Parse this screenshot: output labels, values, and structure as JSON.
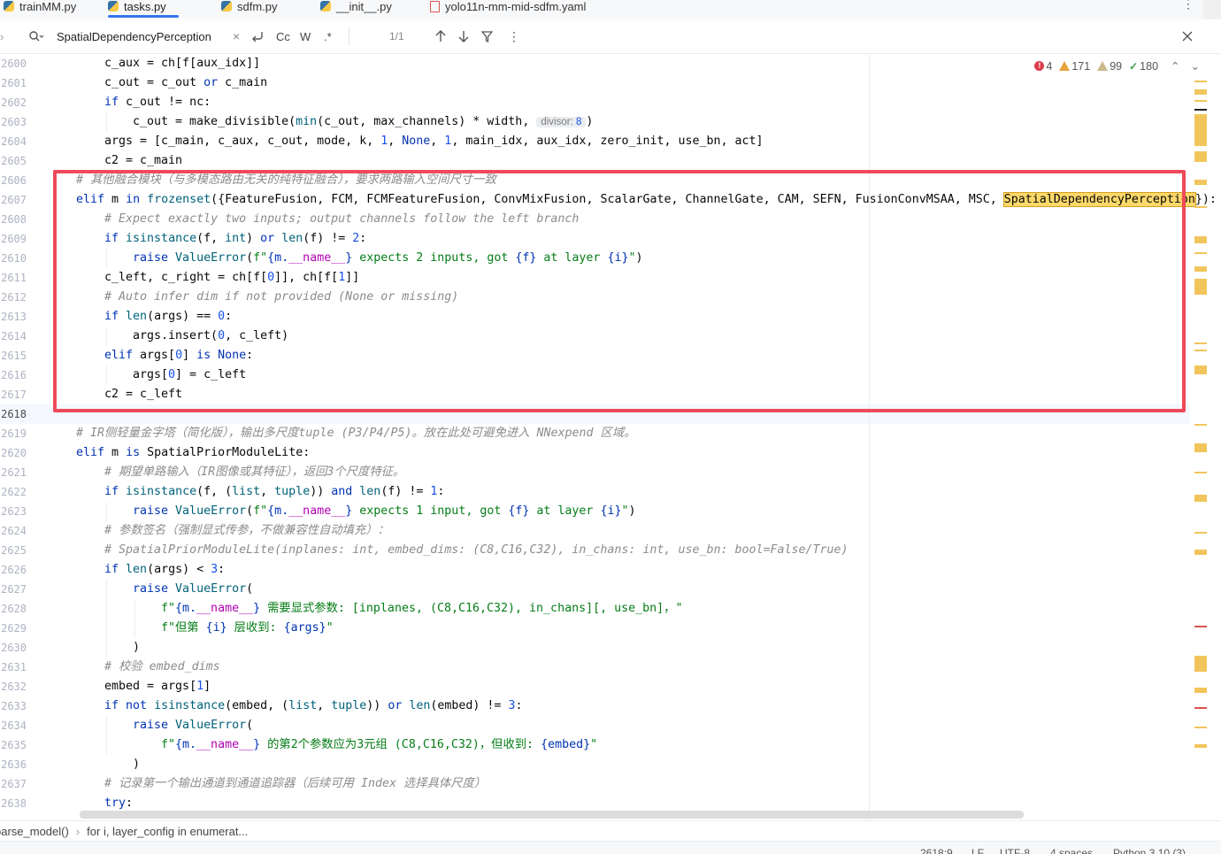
{
  "tabs": [
    {
      "label": "trainMM.py",
      "type": "python",
      "active": false
    },
    {
      "label": "tasks.py",
      "type": "python",
      "active": true
    },
    {
      "label": "sdfm.py",
      "type": "python",
      "active": false
    },
    {
      "label": "__init__.py",
      "type": "python",
      "active": false
    },
    {
      "label": "yolo11n-mm-mid-sdfm.yaml",
      "type": "yaml",
      "active": false
    }
  ],
  "find": {
    "query": "SpatialDependencyPerception",
    "match_case": "Cc",
    "words": "W",
    "regex": ".*",
    "result_count": "1/1"
  },
  "inspections": {
    "errors": "4",
    "warnings": "171",
    "weak_warnings": "99",
    "typos": "180"
  },
  "gutter": {
    "lines": [
      "2600",
      "2601",
      "2602",
      "2603",
      "2604",
      "2605",
      "2606",
      "2607",
      "2608",
      "2609",
      "2610",
      "2611",
      "2612",
      "2613",
      "2614",
      "2615",
      "2616",
      "2617",
      "2618",
      "2619",
      "2620",
      "2621",
      "2622",
      "2623",
      "2624",
      "2625",
      "2626",
      "2627",
      "2628",
      "2629",
      "2630",
      "2631",
      "2632",
      "2633",
      "2634",
      "2635",
      "2636",
      "2637",
      "2638"
    ]
  },
  "code": {
    "l2600": "c_aux = ch[f[aux_idx]]",
    "l2601a": "c_out = c_out ",
    "l2601b": "or",
    "l2601c": " c_main",
    "l2602a": "if",
    "l2602b": " c_out != nc:",
    "l2603a": "c_out = make_divisible(",
    "l2603b": "min",
    "l2603c": "(c_out, max_channels) * width, ",
    "l2603_hint": "divisor:",
    "l2603_hint_val": "8",
    "l2603d": ")",
    "l2604a": "args = [c_main, c_aux, c_out, mode, k, ",
    "l2604n1": "1",
    "l2604b": ", ",
    "l2604none": "None",
    "l2604c": ", ",
    "l2604n2": "1",
    "l2604d": ", main_idx, aux_idx, zero_init, use_bn, act]",
    "l2605": "c2 = c_main",
    "l2606": "# 其他融合模块（与多模态路由无关的纯特征融合），要求两路输入空间尺寸一致",
    "l2607a": "elif",
    "l2607b": " m ",
    "l2607c": "in",
    "l2607d": " ",
    "l2607e": "frozenset",
    "l2607f": "({FeatureFusion, FCM, FCMFeatureFusion, ConvMixFusion, ScalarGate, ChannelGate, CAM, SEFN, FusionConvMSAA, MSC, ",
    "l2607match": "SpatialDependencyPerception",
    "l2607g": "}):",
    "l2608": "# Expect exactly two inputs; output channels follow the left branch",
    "l2609a": "if",
    "l2609b": " ",
    "l2609c": "isinstance",
    "l2609d": "(f, ",
    "l2609e": "int",
    "l2609f": ") ",
    "l2609g": "or",
    "l2609h": " ",
    "l2609i": "len",
    "l2609j": "(f) != ",
    "l2609k": "2",
    "l2609l": ":",
    "l2610a": "raise",
    "l2610b": " ",
    "l2610c": "ValueError",
    "l2610d": "(",
    "l2610e": "f\"",
    "l2610f": "{m.",
    "l2610g": "__name__",
    "l2610h": "}",
    "l2610i": " expects 2 inputs, got ",
    "l2610j": "{f}",
    "l2610k": " at layer ",
    "l2610l": "{i}",
    "l2610m": "\"",
    "l2610n": ")",
    "l2611a": "c_left, c_right = ch[f[",
    "l2611b": "0",
    "l2611c": "]], ch[f[",
    "l2611d": "1",
    "l2611e": "]]",
    "l2612": "# Auto infer dim if not provided (None or missing)",
    "l2613a": "if",
    "l2613b": " ",
    "l2613c": "len",
    "l2613d": "(args) == ",
    "l2613e": "0",
    "l2613f": ":",
    "l2614a": "args.insert(",
    "l2614b": "0",
    "l2614c": ", c_left)",
    "l2615a": "elif",
    "l2615b": " args[",
    "l2615c": "0",
    "l2615d": "] ",
    "l2615e": "is",
    "l2615f": " ",
    "l2615g": "None",
    "l2615h": ":",
    "l2616a": "args[",
    "l2616b": "0",
    "l2616c": "] = c_left",
    "l2617": "c2 = c_left",
    "l2619": "# IR侧轻量金字塔（简化版），输出多尺度tuple (P3/P4/P5)。放在此处可避免进入 NNexpend 区域。",
    "l2620a": "elif",
    "l2620b": " m ",
    "l2620c": "is",
    "l2620d": " SpatialPriorModuleLite:",
    "l2621": "# 期望单路输入（IR图像或其特征），返回3个尺度特征。",
    "l2622a": "if",
    "l2622b": " ",
    "l2622c": "isinstance",
    "l2622d": "(f, (",
    "l2622e": "list",
    "l2622f": ", ",
    "l2622g": "tuple",
    "l2622h": ")) ",
    "l2622i": "and",
    "l2622j": " ",
    "l2622k": "len",
    "l2622l": "(f) != ",
    "l2622m": "1",
    "l2622n": ":",
    "l2623a": "raise",
    "l2623b": " ",
    "l2623c": "ValueError",
    "l2623d": "(",
    "l2623e": "f\"",
    "l2623f": "{m.",
    "l2623g": "__name__",
    "l2623h": "}",
    "l2623i": " expects 1 input, got ",
    "l2623j": "{f}",
    "l2623k": " at layer ",
    "l2623l": "{i}",
    "l2623m": "\"",
    "l2623n": ")",
    "l2624": "# 参数签名（强制显式传参，不做兼容性自动填充）：",
    "l2625": "# SpatialPriorModuleLite(inplanes: int, embed_dims: (C8,C16,C32), in_chans: int, use_bn: bool=False/True)",
    "l2626a": "if",
    "l2626b": " ",
    "l2626c": "len",
    "l2626d": "(args) < ",
    "l2626e": "3",
    "l2626f": ":",
    "l2627a": "raise",
    "l2627b": " ",
    "l2627c": "ValueError",
    "l2627d": "(",
    "l2628a": "f\"",
    "l2628b": "{m.",
    "l2628c": "__name__",
    "l2628d": "}",
    "l2628e": " 需要显式参数: [inplanes, (C8,C16,C32), in_chans][, use_bn]，\"",
    "l2629a": "f\"但第 ",
    "l2629b": "{i}",
    "l2629c": " 层收到: ",
    "l2629d": "{args}",
    "l2629e": "\"",
    "l2630": ")",
    "l2631": "# 校验 embed_dims",
    "l2632a": "embed = args[",
    "l2632b": "1",
    "l2632c": "]",
    "l2633a": "if",
    "l2633b": " ",
    "l2633c": "not",
    "l2633d": " ",
    "l2633e": "isinstance",
    "l2633f": "(embed, (",
    "l2633g": "list",
    "l2633h": ", ",
    "l2633i": "tuple",
    "l2633j": ")) ",
    "l2633k": "or",
    "l2633l": " ",
    "l2633m": "len",
    "l2633n": "(embed) != ",
    "l2633o": "3",
    "l2633p": ":",
    "l2634a": "raise",
    "l2634b": " ",
    "l2634c": "ValueError",
    "l2634d": "(",
    "l2635a": "f\"",
    "l2635b": "{m.",
    "l2635c": "__name__",
    "l2635d": "}",
    "l2635e": " 的第2个参数应为3元组 (C8,C16,C32)，但收到: ",
    "l2635f": "{embed}",
    "l2635g": "\"",
    "l2636": ")",
    "l2637": "# 记录第一个输出通道到通道追踪器（后续可用 Index 选择具体尺度）",
    "l2638a": "try",
    "l2638b": ":"
  },
  "breadcrumb": [
    "parse_model()",
    "for i, layer_config in enumerat..."
  ],
  "status": {
    "position": "2618:9",
    "line_sep": "LF",
    "encoding": "UTF-8",
    "indent": "4 spaces",
    "interpreter": "Python 3.10 (3)"
  },
  "colors": {
    "annotation_box": "#ef4a5a",
    "search_match": "#fed96a",
    "keyword": "#0033b3",
    "string": "#067d17",
    "number": "#1750eb",
    "comment": "#8c8c8c",
    "tab_underline": "#3574f0"
  }
}
